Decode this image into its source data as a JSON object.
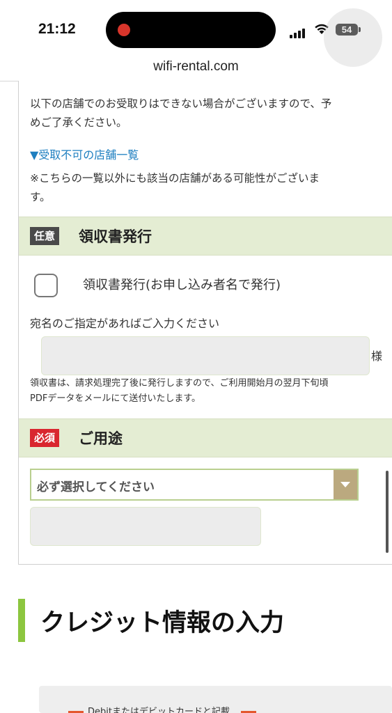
{
  "status_bar": {
    "time": "21:12",
    "battery": "54",
    "icons": [
      "signal-icon",
      "wifi-icon",
      "battery-icon",
      "recording-indicator"
    ]
  },
  "browser": {
    "url": "wifi-rental.com"
  },
  "notice": {
    "line1": "以下の店舗でのお受取りはできない場合がございますので、予",
    "line2": "めご了承ください。",
    "store_link": "▼受取不可の店舗一覧",
    "line3": "※こちらの一覧以外にも該当の店舗がある可能性がございま",
    "line4": "す。"
  },
  "receipt_section": {
    "badge": "任意",
    "title": "領収書発行",
    "checkbox_label": "領収書発行(お申し込み者名で発行)",
    "checkbox_checked": false,
    "addressee_label": "宛名のご指定があればご入力ください",
    "addressee_value": "",
    "suffix": "様",
    "note_line1": "領収書は、請求処理完了後に発行しますので、ご利用開始月の翌月下旬頃",
    "note_line2": "PDFデータをメールにて送付いたします。"
  },
  "usage_section": {
    "badge": "必須",
    "title": "ご用途",
    "select_value": "必ず選択してください",
    "other_value": ""
  },
  "credit_section": {
    "title": "クレジット情報の入力",
    "card_caption": "Debitまたはデビットカードと記載"
  },
  "colors": {
    "section_bg": "#e4edd3",
    "badge_optional": "#4a4a4a",
    "badge_required": "#d9262f",
    "link": "#1e7fc0",
    "accent_green": "#8cc63f",
    "select_arrow_bg": "#bba97f"
  }
}
